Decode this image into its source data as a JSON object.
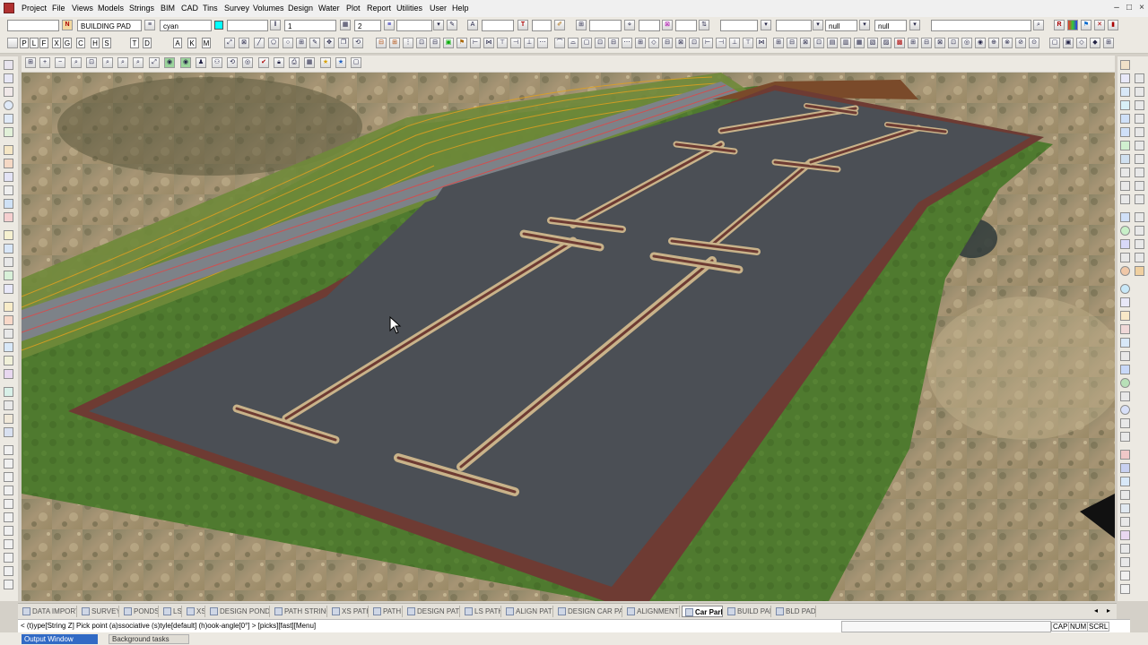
{
  "menu": [
    "Project",
    "File",
    "Views",
    "Models",
    "Strings",
    "BIM",
    "CAD",
    "Tins",
    "Survey",
    "Volumes",
    "Design",
    "Water",
    "Plot",
    "Report",
    "Utilities",
    "User",
    "Help"
  ],
  "window_controls": [
    "–",
    "□",
    "×"
  ],
  "toolbar1": {
    "model_name": "BUILDING PAD",
    "colour_name": "cyan",
    "colour_hex": "#00ffff",
    "weight_value": "1",
    "style_value": "2",
    "null_a": "null",
    "null_b": "null"
  },
  "toolbar2_letters": [
    "P",
    "L",
    "F",
    "X",
    "G",
    "C",
    "H",
    "S",
    "T",
    "D",
    "A",
    "K",
    "M"
  ],
  "tabs": [
    "DATA IMPORT",
    "SURVEY",
    "PONDS",
    "LS",
    "XS",
    "DESIGN PONDS",
    "PATH STRING",
    "XS PATH",
    "PATH",
    "DESIGN PATH",
    "LS PATH",
    "ALIGN PATH",
    "DESIGN CAR PAR",
    "ALIGNMENTS",
    "Car Park",
    "BUILD PAD",
    "BLD PAD"
  ],
  "active_tab": "Car Park",
  "command_line": "< (t)ype[String Z] Pick point (a)ssociative (s)tyle[default] (h)ook-angle[0°] > [picks][fast][Menu]",
  "status_indicators": [
    "CAP",
    "NUM",
    "SCRL"
  ],
  "bottom_tabs": [
    "Output Window",
    "Background tasks"
  ],
  "colors": {
    "asphalt": "#4b4f55",
    "kerb": "#6e3b33",
    "grass": "#4f7a2f",
    "island": "#c9b38a",
    "accent_blue": "#316ac5"
  }
}
